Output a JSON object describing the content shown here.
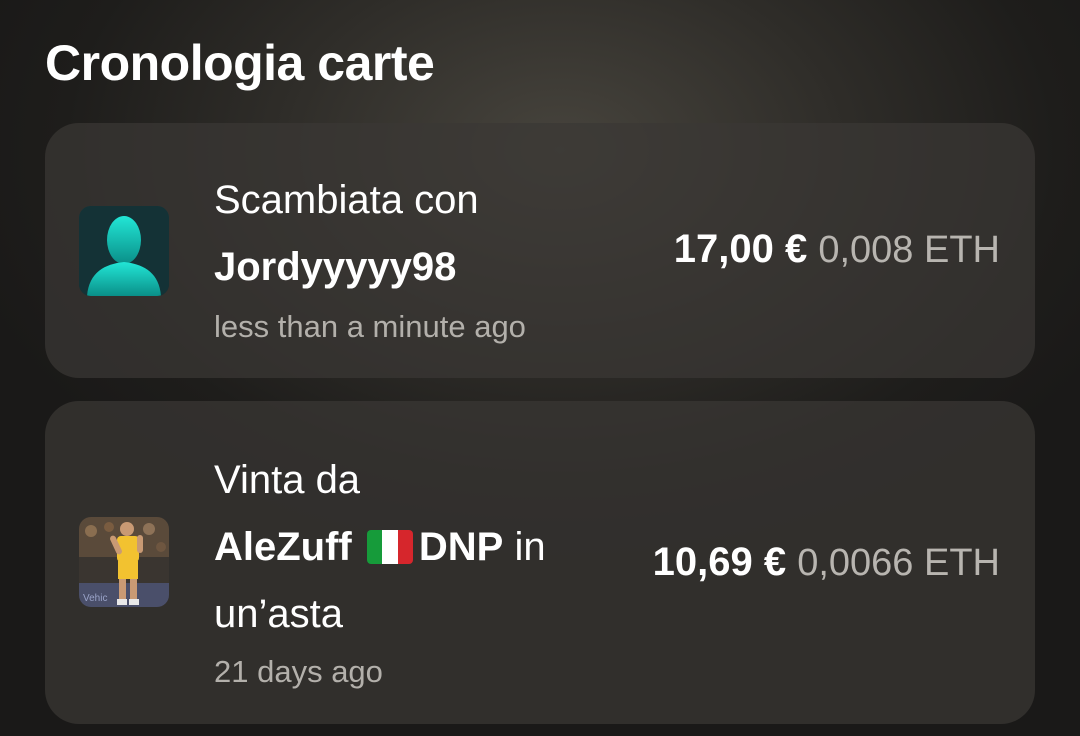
{
  "header": {
    "title": "Cronologia carte"
  },
  "history": [
    {
      "action": "Scambiata con",
      "user": "Jordyyyyy98",
      "time": "less than a minute ago",
      "price_eur": "17,00 €",
      "price_eth": "0,008 ETH"
    },
    {
      "action": "Vinta da",
      "user": "AleZuff",
      "flag_colors": [
        "#169b3a",
        "#ffffff",
        "#d6262c"
      ],
      "user_suffix": "DNP",
      "suffix_text": "in",
      "suffix_line2": "un’asta",
      "time": "21 days ago",
      "price_eur": "10,69 €",
      "price_eth": "0,0066 ETH"
    }
  ]
}
